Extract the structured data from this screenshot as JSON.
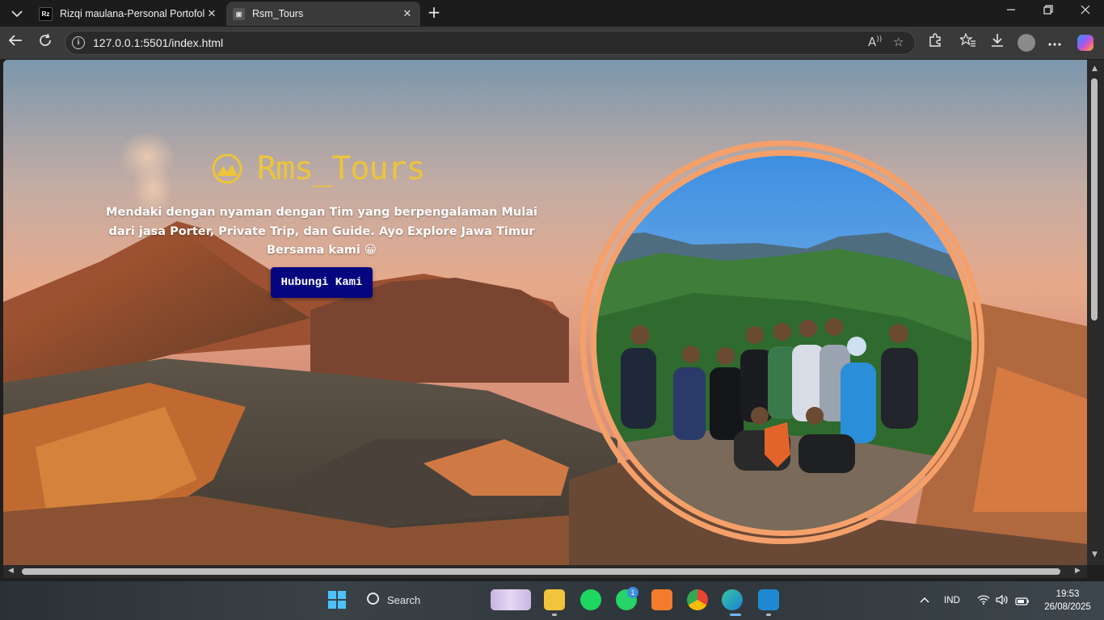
{
  "browser": {
    "tabs": [
      {
        "label": "Rizqi maulana-Personal Portofolio",
        "favicon": "Rz",
        "active": false
      },
      {
        "label": "Rsm_Tours",
        "favicon": "▣",
        "active": true
      }
    ],
    "tab_close_glyph": "✕",
    "new_tab_glyph": "+",
    "url": "127.0.0.1:5501/index.html"
  },
  "page": {
    "brand_name": "Rms_Tours",
    "tagline": "Mendaki dengan nyaman dengan Tim yang berpengalaman Mulai dari jasa Porter, Private Trip, dan Guide. Ayo Explore Jawa Timur Bersama kami 😀",
    "cta_label": "Hubungi Kami",
    "colors": {
      "brand": "#ecc53a",
      "cta_bg": "#05057f",
      "ring": "#f5a06a"
    }
  },
  "taskbar": {
    "search_label": "Search",
    "whatsapp_badge": "1",
    "language": "IND",
    "time": "19:53",
    "date": "26/08/2025"
  }
}
